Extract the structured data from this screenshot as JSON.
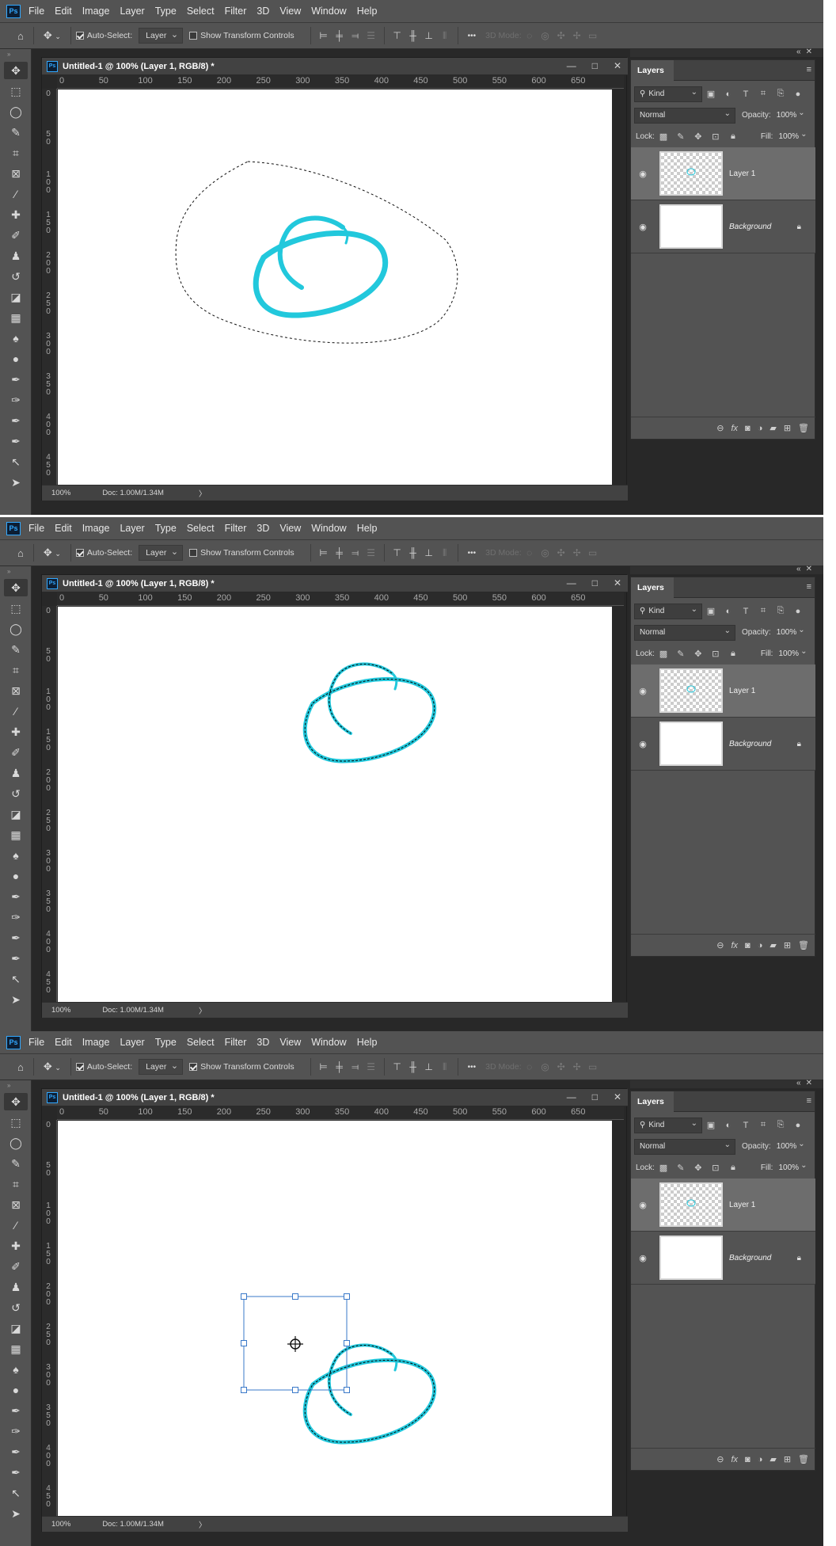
{
  "menu": [
    "File",
    "Edit",
    "Image",
    "Layer",
    "Type",
    "Select",
    "Filter",
    "3D",
    "View",
    "Window",
    "Help"
  ],
  "app_logo": "Ps",
  "options": {
    "auto_select_label": "Auto-Select:",
    "target_value": "Layer",
    "show_transform_label": "Show Transform Controls",
    "more_label": "•••",
    "mode3d_label": "3D Mode:"
  },
  "document": {
    "title": "Untitled-1 @ 100% (Layer 1, RGB/8) *",
    "zoom": "100%",
    "doc_info": "Doc: 1.00M/1.34M",
    "ruler_h": [
      "0",
      "50",
      "100",
      "150",
      "200",
      "250",
      "300",
      "350",
      "400",
      "450",
      "500",
      "550",
      "600",
      "650"
    ],
    "ruler_v": [
      [
        "0"
      ],
      [
        "5",
        "0"
      ],
      [
        "1",
        "0",
        "0"
      ],
      [
        "1",
        "5",
        "0"
      ],
      [
        "2",
        "0",
        "0"
      ],
      [
        "2",
        "5",
        "0"
      ],
      [
        "3",
        "0",
        "0"
      ],
      [
        "3",
        "5",
        "0"
      ],
      [
        "4",
        "0",
        "0"
      ],
      [
        "4",
        "5",
        "0"
      ]
    ]
  },
  "layers_panel": {
    "tab": "Layers",
    "kind_value": "Kind",
    "blend_mode": "Normal",
    "opacity_label": "Opacity:",
    "opacity_value": "100%",
    "lock_label": "Lock:",
    "fill_label": "Fill:",
    "fill_value": "100%",
    "items": [
      {
        "name": "Layer 1",
        "selected": true
      },
      {
        "name": "Background",
        "selected": false,
        "locked": true
      }
    ]
  },
  "frames": [
    {
      "show_transform_checked": false,
      "state": "lasso-selection"
    },
    {
      "show_transform_checked": false,
      "state": "stroke-selected"
    },
    {
      "show_transform_checked": true,
      "state": "transform-controls"
    }
  ],
  "stroke_color": "#22c8dc"
}
